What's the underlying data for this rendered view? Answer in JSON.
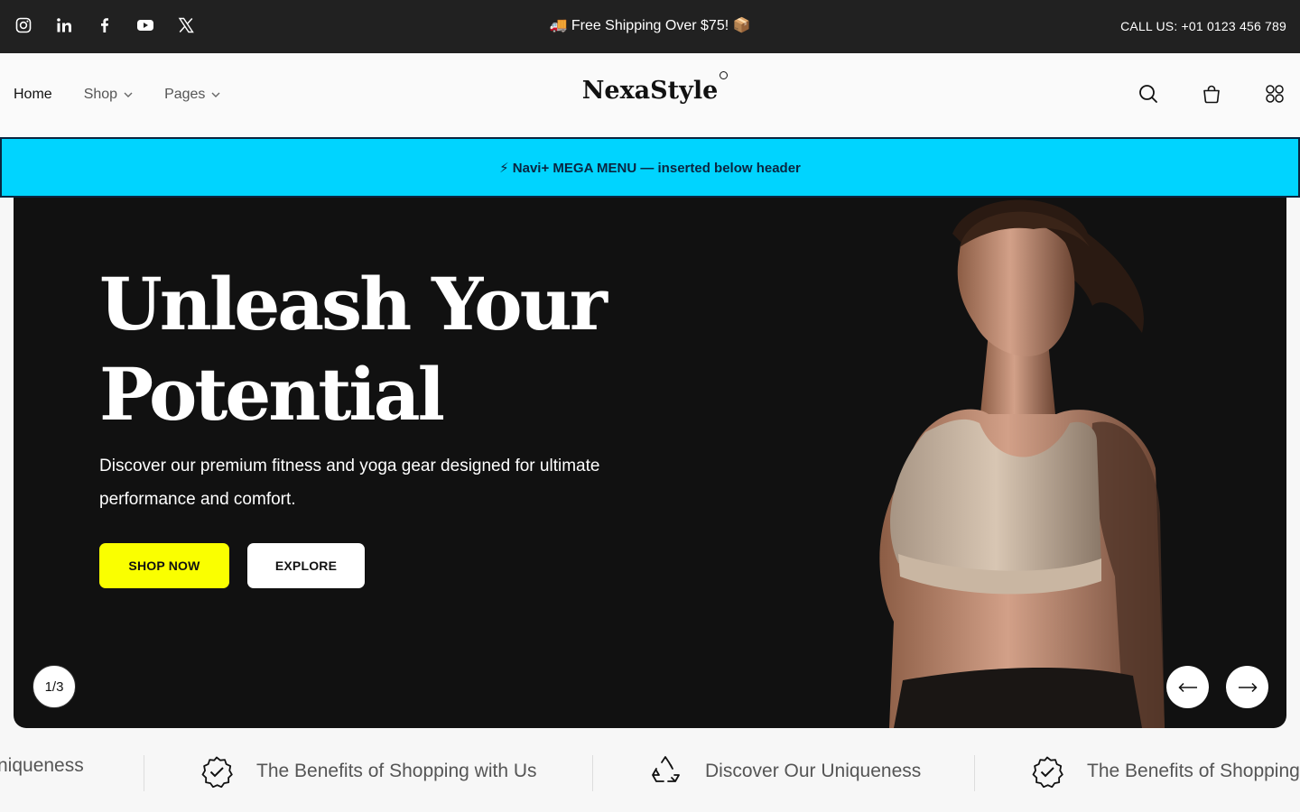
{
  "topbar": {
    "social": [
      "instagram-icon",
      "linkedin-icon",
      "facebook-icon",
      "youtube-icon",
      "x-icon"
    ],
    "promo": "🚚 Free Shipping Over $75! 📦",
    "call": "CALL US: +01 0123 456 789"
  },
  "header": {
    "nav": {
      "home": "Home",
      "shop": "Shop",
      "pages": "Pages"
    },
    "logo": "NexaStyle",
    "icons": [
      "search-icon",
      "bag-icon",
      "grid-icon"
    ]
  },
  "mega_menu": {
    "text": "⚡ Navi+ MEGA MENU — inserted below header"
  },
  "hero": {
    "title_line1": "Unleash Your",
    "title_line2": "Potential",
    "description": "Discover our premium fitness and yoga gear designed for ultimate performance and comfort.",
    "shop_now": "SHOP NOW",
    "explore": "EXPLORE",
    "slide_counter": "1/3",
    "prev_arrow": "⟵",
    "next_arrow": "⟶"
  },
  "marquee": {
    "item_partial": "niqueness",
    "item1": "The Benefits of Shopping with Us",
    "item2": "Discover Our Uniqueness",
    "item3": "The Benefits of Shopping"
  },
  "colors": {
    "topbar": "#212121",
    "mega": "#00d4ff",
    "hero": "#111111",
    "accent": "#faff00"
  }
}
